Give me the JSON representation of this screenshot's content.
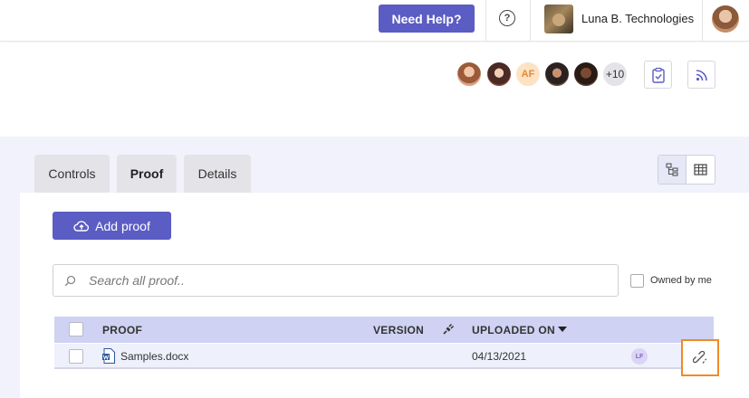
{
  "header": {
    "help_label": "Need Help?",
    "org_name": "Luna B. Technologies",
    "icons": [
      "help-circle-icon",
      "org-avatar",
      "user-avatar"
    ]
  },
  "collaborators": {
    "initials": "AF",
    "more_count": "+10"
  },
  "tabs": [
    {
      "label": "Controls",
      "active": false
    },
    {
      "label": "Proof",
      "active": true
    },
    {
      "label": "Details",
      "active": false
    }
  ],
  "actions": {
    "add_proof_label": "Add proof"
  },
  "search": {
    "placeholder": "Search all proof.."
  },
  "filter": {
    "owned_by_me_label": "Owned by me",
    "owned_by_me_checked": false
  },
  "table": {
    "columns": {
      "proof": "PROOF",
      "version": "VERSION",
      "uploaded_on": "UPLOADED ON"
    },
    "sort": {
      "column": "uploaded_on",
      "direction": "desc"
    },
    "rows": [
      {
        "name": "Samples.docx",
        "version": "",
        "uploaded_on": "04/13/2021",
        "owner_initials": "LF",
        "file_type": "word"
      }
    ]
  },
  "colors": {
    "accent": "#5b5cc4",
    "highlight": "#f08a24",
    "table_header": "#cfd2f2"
  }
}
